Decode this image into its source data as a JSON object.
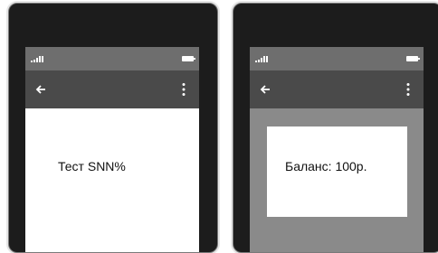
{
  "screens": [
    {
      "icons": {
        "signal": "signal-icon",
        "battery": "battery-icon",
        "back": "back-arrow-icon",
        "menu": "more-vert-icon"
      },
      "content_text": "Тест SNN%"
    },
    {
      "icons": {
        "signal": "signal-icon",
        "battery": "battery-icon",
        "back": "back-arrow-icon",
        "menu": "more-vert-icon"
      },
      "dialog_text": "Баланс: 100р."
    }
  ],
  "colors": {
    "phone_frame": "#1c1c1c",
    "status_bar": "#6e6e6e",
    "toolbar": "#4a4a4a",
    "scrim": "#8a8a8a",
    "surface": "#ffffff"
  }
}
